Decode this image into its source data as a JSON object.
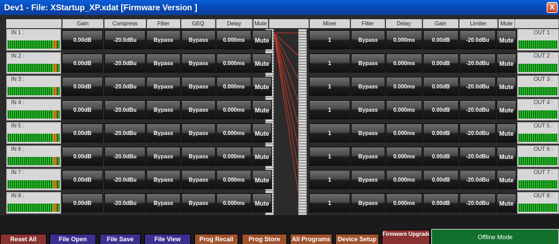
{
  "window": {
    "title": "Dev1 -   File: XStartup_XP.xdat [Firmware Version ]",
    "close_glyph": "X"
  },
  "headers": {
    "input": [
      "Gain",
      "Compress",
      "Filter",
      "GEQ",
      "Delay",
      "Mute"
    ],
    "output": [
      "Mixer",
      "Filter",
      "Delay",
      "Gain",
      "Limiter",
      "Mute"
    ]
  },
  "inputs": [
    {
      "label": "IN 1 :",
      "gain": "0.00dB",
      "compress": "-20.0dBu",
      "filter": "Bypass",
      "geq": "Bypass",
      "delay": "0.000ms",
      "mute": "Mute"
    },
    {
      "label": "IN 2 :",
      "gain": "0.00dB",
      "compress": "-20.0dBu",
      "filter": "Bypass",
      "geq": "Bypass",
      "delay": "0.000ms",
      "mute": "Mute"
    },
    {
      "label": "IN 3 :",
      "gain": "0.00dB",
      "compress": "-20.0dBu",
      "filter": "Bypass",
      "geq": "Bypass",
      "delay": "0.000ms",
      "mute": "Mute"
    },
    {
      "label": "IN 4 :",
      "gain": "0.00dB",
      "compress": "-20.0dBu",
      "filter": "Bypass",
      "geq": "Bypass",
      "delay": "0.000ms",
      "mute": "Mute"
    },
    {
      "label": "IN 5 :",
      "gain": "0.00dB",
      "compress": "-20.0dBu",
      "filter": "Bypass",
      "geq": "Bypass",
      "delay": "0.000ms",
      "mute": "Mute"
    },
    {
      "label": "IN 6 :",
      "gain": "0.00dB",
      "compress": "-20.0dBu",
      "filter": "Bypass",
      "geq": "Bypass",
      "delay": "0.000ms",
      "mute": "Mute"
    },
    {
      "label": "IN 7 :",
      "gain": "0.00dB",
      "compress": "-20.0dBu",
      "filter": "Bypass",
      "geq": "Bypass",
      "delay": "0.000ms",
      "mute": "Mute"
    },
    {
      "label": "IN 8 :",
      "gain": "0.00dB",
      "compress": "-20.0dBu",
      "filter": "Bypass",
      "geq": "Bypass",
      "delay": "0.000ms",
      "mute": "Mute"
    }
  ],
  "outputs": [
    {
      "label": "OUT 1 :",
      "mixer": "1",
      "filter": "Bypass",
      "delay": "0.000ms",
      "gain": "0.00dB",
      "limiter": "-20.0dBu",
      "mute": "Mute"
    },
    {
      "label": "OUT 2 :",
      "mixer": "1",
      "filter": "Bypass",
      "delay": "0.000ms",
      "gain": "0.00dB",
      "limiter": "-20.0dBu",
      "mute": "Mute"
    },
    {
      "label": "OUT 3 :",
      "mixer": "1",
      "filter": "Bypass",
      "delay": "0.000ms",
      "gain": "0.00dB",
      "limiter": "-20.0dBu",
      "mute": "Mute"
    },
    {
      "label": "OUT 4 :",
      "mixer": "1",
      "filter": "Bypass",
      "delay": "0.000ms",
      "gain": "0.00dB",
      "limiter": "-20.0dBu",
      "mute": "Mute"
    },
    {
      "label": "OUT 5 :",
      "mixer": "1",
      "filter": "Bypass",
      "delay": "0.000ms",
      "gain": "0.00dB",
      "limiter": "-20.0dBu",
      "mute": "Mute"
    },
    {
      "label": "OUT 6 :",
      "mixer": "1",
      "filter": "Bypass",
      "delay": "0.000ms",
      "gain": "0.00dB",
      "limiter": "-20.0dBu",
      "mute": "Mute"
    },
    {
      "label": "OUT 7 :",
      "mixer": "1",
      "filter": "Bypass",
      "delay": "0.000ms",
      "gain": "0.00dB",
      "limiter": "-20.0dBu",
      "mute": "Mute"
    },
    {
      "label": "OUT 8 :",
      "mixer": "1",
      "filter": "Bypass",
      "delay": "0.000ms",
      "gain": "0.00dB",
      "limiter": "-20.0dBu",
      "mute": "Mute"
    }
  ],
  "bottom_buttons": [
    {
      "label": "Reset All",
      "color": "#8a3232"
    },
    {
      "label": "File Open",
      "color": "#3b2f8f"
    },
    {
      "label": "File Save",
      "color": "#3b2f8f"
    },
    {
      "label": "File View",
      "color": "#3b2f8f"
    },
    {
      "label": "Prog Recall",
      "color": "#a0522d"
    },
    {
      "label": "Prog Store",
      "color": "#a0522d"
    },
    {
      "label": "All Programs",
      "color": "#a0522d"
    },
    {
      "label": "Device Setup",
      "color": "#a0522d"
    },
    {
      "label": "Firmware Upgrade",
      "color": "#8a3232"
    }
  ],
  "status": {
    "mode": "Offline Mode",
    "color": "#11702b"
  }
}
